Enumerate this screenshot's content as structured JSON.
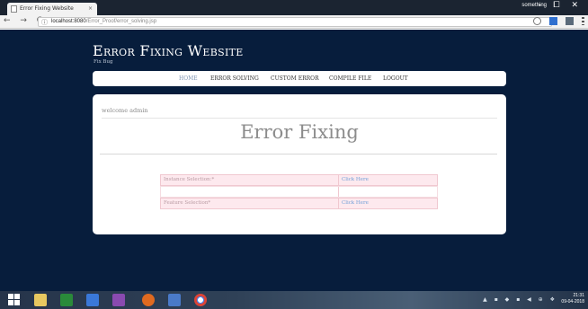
{
  "browser": {
    "tab_title": "Error Fixing Website",
    "tab_close": "×",
    "profile_name": "something",
    "window_controls": "– ⧠ ✕",
    "nav_icons": "← → C",
    "info_icon": "ⓘ",
    "url_host": "localhost:8080",
    "url_path": "/Error_Proof/error_solving.jsp"
  },
  "site": {
    "title": "Error Fixing Website",
    "subtitle": "Fix Bug"
  },
  "menu": {
    "items": [
      {
        "label": "HOME",
        "active": true
      },
      {
        "label": "ERROR SOLVING",
        "active": false
      },
      {
        "label": "CUSTOM ERROR",
        "active": false
      },
      {
        "label": "COMPILE FILE",
        "active": false
      },
      {
        "label": "LOGOUT",
        "active": false
      }
    ]
  },
  "main": {
    "welcome": "welcome admin",
    "heading": "Error Fixing",
    "rows": [
      {
        "label": "Instance Selection:*",
        "link": "Click Here"
      },
      {
        "label": "",
        "link": ""
      },
      {
        "label": "Feature Selection*",
        "link": "Click Here"
      }
    ]
  },
  "taskbar": {
    "time": "21:31",
    "date": "09-04-2018",
    "tray_glyphs": "▲ ▪ ◆ ▪ ◀ ⊕ ❖"
  },
  "colors": {
    "page_bg": "#071d3c",
    "link": "#6f9fd8",
    "row_pink": "#fde9ee"
  }
}
